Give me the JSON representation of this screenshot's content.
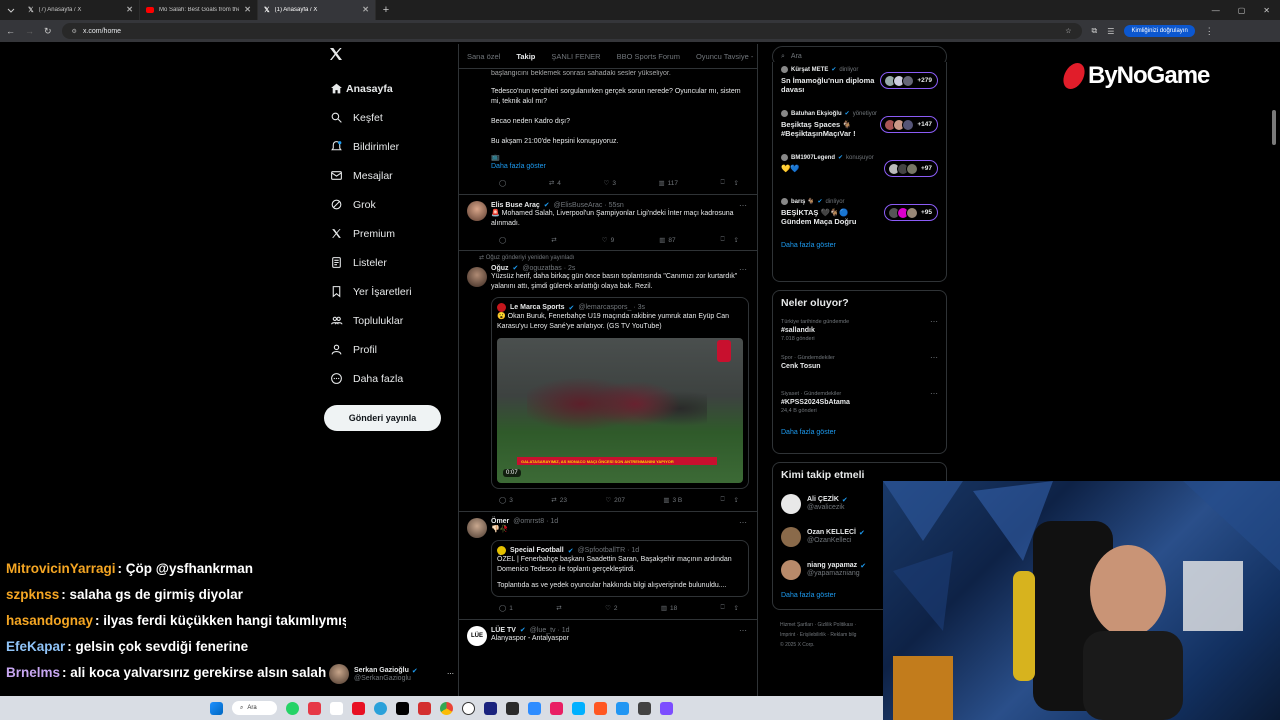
{
  "browser": {
    "tabs": [
      {
        "title": "(7) Anasayfa / X",
        "icon": "x-logo-icon"
      },
      {
        "title": "Mo Salah: Best Goals from the",
        "icon": "youtube-icon"
      },
      {
        "title": "(1) Anasayfa / X",
        "icon": "x-logo-icon",
        "active": true
      }
    ],
    "url": "x.com/home",
    "signin": "Kimliğinizi doğrulayın"
  },
  "nav": {
    "items": [
      {
        "label": "Anasayfa",
        "icon": "home-icon",
        "active": true
      },
      {
        "label": "Keşfet",
        "icon": "search-icon"
      },
      {
        "label": "Bildirimler",
        "icon": "bell-icon"
      },
      {
        "label": "Mesajlar",
        "icon": "mail-icon"
      },
      {
        "label": "Grok",
        "icon": "grok-icon"
      },
      {
        "label": "Premium",
        "icon": "x-logo-icon"
      },
      {
        "label": "Listeler",
        "icon": "list-icon"
      },
      {
        "label": "Yer İşaretleri",
        "icon": "bookmark-icon"
      },
      {
        "label": "Topluluklar",
        "icon": "communities-icon"
      },
      {
        "label": "Profil",
        "icon": "person-icon"
      },
      {
        "label": "Daha fazla",
        "icon": "more-circle-icon"
      }
    ],
    "post_button": "Gönderi yayınla"
  },
  "feed": {
    "tabs": [
      "Sana özel",
      "Takip",
      "ŞANLI FENER",
      "BBO Sports Forum",
      "Oyuncu Tavsiye -"
    ],
    "active_tab": "Takip",
    "top_tweet": {
      "line0": "başlangıcını beklemek sonrası sahadaki sesler yükseliyor.",
      "line1": "Tedesco'nun tercihleri sorgulanırken gerçek sorun nerede? Oyuncular mı, sistem mi, teknik akıl mı?",
      "line2": "Becao neden Kadro dışı?",
      "line3": "Bu akşam 21:00'de hepsini konuşuyoruz.",
      "emoji": "📺",
      "show_more": "Daha fazla göster",
      "retweets": "4",
      "likes": "3",
      "views": "117"
    },
    "tweet2": {
      "name": "Elis Buse Araç",
      "handle": "@ElisBuseArac · 55sn",
      "text": "🚨 Mohamed Salah, Liverpool'un Şampiyonlar Ligi'ndeki İnter maçı kadrosuna alınmadı.",
      "likes": "9",
      "views": "87"
    },
    "tweet3": {
      "repost_note": "Oğuz gönderiyi yeniden yayınladı",
      "name": "Oğuz",
      "handle": "@oguzatbas · 2s",
      "text": "Yüzsüz herif, daha birkaç gün önce basın toplantısında \"Canımızı zor kurtardık\" yalanını attı, şimdi gülerek anlattığı olaya bak. Rezil.",
      "quote_name": "Le Marca Sports",
      "quote_handle": "@lemarcaspors_ · 3s",
      "quote_text": "😮 Okan Buruk, Fenerbahçe U19 maçında rakibine yumruk atan Eyüp Can Karasu'yu Leroy Sané'ye anlatıyor. (GS TV YouTube)",
      "video_caption": "GALATASARAYIMIZ, AS MONACO MAÇI ÖNCESİ SON ANTRENMANINI YAPIYOR",
      "video_time": "0:07",
      "replies": "3",
      "retweets": "23",
      "likes": "207",
      "views": "3 B"
    },
    "tweet4": {
      "name": "Ömer",
      "handle": "@omrrst8 · 1d",
      "emoji": "👎🏻🥀",
      "quote_name": "Special Football",
      "quote_handle": "@SpfootballTR · 1d",
      "quote_text1": "ÖZEL | Fenerbahçe başkanı Saadettin Saran, Başakşehir maçının ardından Domenico Tedesco ile toplantı gerçekleştirdi.",
      "quote_text2": "Toplantıda as ve yedek oyuncular hakkında bilgi alışverişinde bulunuldu....",
      "replies": "1",
      "likes": "2",
      "views": "18"
    },
    "tweet5": {
      "name": "LÜE TV",
      "handle": "@lue_tv · 1d",
      "text": "Alanyaspor - Antalyaspor"
    }
  },
  "right": {
    "search_placeholder": "Ara",
    "spaces": [
      {
        "host": "Kürşat METE",
        "role": "dinliyor",
        "title": "Sn İmamoğlu'nun diploma davası",
        "count": "+279"
      },
      {
        "host": "Batuhan Ekşioğlu",
        "role": "yönetiyor",
        "title": "Beşiktaş Spaces 🐐 #BeşiktaşınMaçıVar !",
        "count": "+147"
      },
      {
        "host": "BM1907Legend",
        "role": "konuşuyor",
        "title": "💛💙",
        "count": "+97"
      },
      {
        "host": "barış 🐐",
        "role": "dinliyor",
        "title": "BEŞİKTAŞ 🖤🐐🔵 Gündem Maça Doğru",
        "count": "+95"
      }
    ],
    "spaces_more": "Daha fazla göster",
    "trends_title": "Neler oluyor?",
    "trends": [
      {
        "context": "Türkiye tarihinde gündemde",
        "topic": "#sallandık",
        "count": "7.018 gönderi"
      },
      {
        "context": "Spor · Gündemdekiler",
        "topic": "Cenk Tosun",
        "count": ""
      },
      {
        "context": "Siyaset · Gündemdekiler",
        "topic": "#KPSS2024SbAtama",
        "count": "24,4 B gönderi"
      }
    ],
    "trends_more": "Daha fazla göster",
    "who_title": "Kimi takip etmeli",
    "who": [
      {
        "name": "Ali ÇEZİK",
        "handle": "@avalicezik"
      },
      {
        "name": "Ozan KELLECİ",
        "handle": "@OzanKelleci"
      },
      {
        "name": "niang yapamaz",
        "handle": "@yapamazniang"
      }
    ],
    "who_more": "Daha fazla göster",
    "footer": [
      "Hizmet Şartları",
      "Gizlilik Politikası",
      "Imprint",
      "Erişilebilirlik",
      "Reklam bilg",
      "© 2025 X Corp."
    ]
  },
  "account": {
    "name": "Serkan Gazioğlu",
    "handle": "@SerkanGazioglu"
  },
  "brand": {
    "name": "ByNoGame"
  },
  "chat": [
    {
      "user": "MitrovicinYarragi",
      "color": "#f5a623",
      "message": ": Çöp @ysfhankrman"
    },
    {
      "user": "szpknss",
      "color": "#f5a623",
      "message": ": salaha gs de girmiş diyolar"
    },
    {
      "user": "hasandognay",
      "color": "#f5a623",
      "message": ": ilyas ferdi küçükken hangi takımlıymış"
    },
    {
      "user": "EfeKapar",
      "color": "#8fc3f7",
      "message": ": gelsin çok sevdiği fenerine"
    },
    {
      "user": "Brnelms",
      "color": "#c7a6f0",
      "message": ": ali koca yalvarsırız gerekirse alsın salah ı"
    }
  ],
  "taskbar": {
    "search": "Ara"
  },
  "colors": {
    "accent": "#1d9bf0",
    "spaces_border": "#8b5cf6",
    "bg": "#000000"
  }
}
